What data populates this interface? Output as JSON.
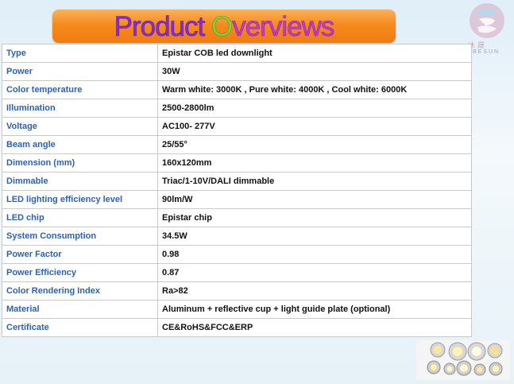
{
  "banner": {
    "title_part1": "Product ",
    "title_part2": "O",
    "title_part3": "verviews"
  },
  "logo": {
    "cn_text": "冰 晟",
    "en_text": "BESUN"
  },
  "specs": [
    {
      "label": "Type",
      "value": "Epistar COB led downlight"
    },
    {
      "label": "Power",
      "value": "30W"
    },
    {
      "label": "Color temperature",
      "value": "Warm white: 3000K , Pure white: 4000K , Cool white: 6000K"
    },
    {
      "label": "Illumination",
      "value": "2500-2800lm"
    },
    {
      "label": "Voltage",
      "value": "AC100- 277V"
    },
    {
      "label": "Beam angle",
      "value": "25/55°"
    },
    {
      "label": "Dimension (mm)",
      "value": "160x120mm"
    },
    {
      "label": "Dimmable",
      "value": "Triac/1-10V/DALI dimmable"
    },
    {
      "label": "LED lighting efficiency level",
      "value": "90lm/W"
    },
    {
      "label": "LED chip",
      "value": "Epistar chip"
    },
    {
      "label": "System Consumption",
      "value": "34.5W"
    },
    {
      "label": "Power Factor",
      "value": "0.98"
    },
    {
      "label": "Power Efficiency",
      "value": "0.87"
    },
    {
      "label": "Color Rendering Index",
      "value": "Ra>82"
    },
    {
      "label": "Material",
      "value": "Aluminum + reflective cup + light guide plate (optional)"
    },
    {
      "label": "Certificate",
      "value": "CE&RoHS&FCC&ERP"
    }
  ],
  "colors": {
    "label_blue": "#2a62b8",
    "banner_orange": "#f68a1e",
    "logo_pink": "#d9a7c0"
  }
}
